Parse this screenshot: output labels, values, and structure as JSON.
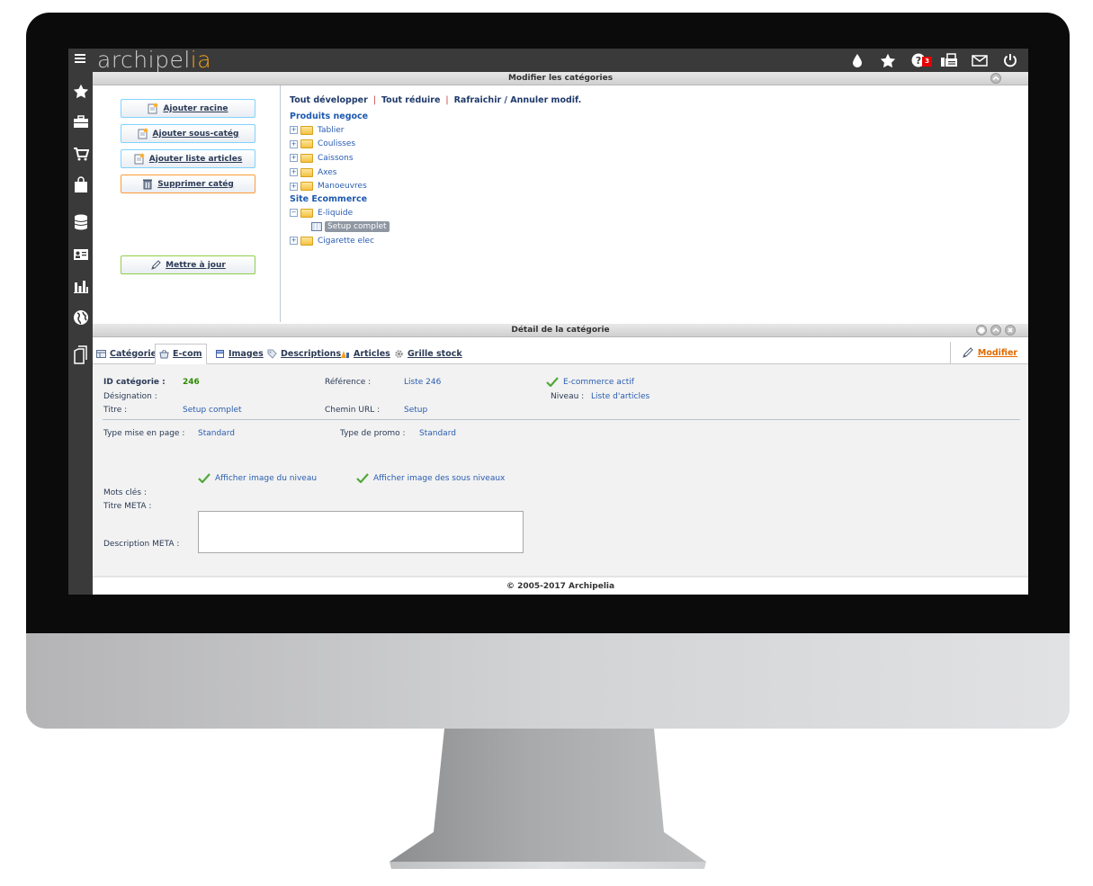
{
  "app": {
    "logo_text": "archipel",
    "logo_accent": "ia",
    "accent_color": "#f3a11a"
  },
  "topbar": {
    "help_badge": "3",
    "icons": [
      "drop-icon",
      "star-icon",
      "help-icon",
      "fax-icon",
      "mail-icon",
      "power-icon"
    ]
  },
  "sidebar": {
    "icons": [
      "star-icon",
      "briefcase-icon",
      "cart-icon",
      "shopping-bag-icon",
      "database-icon",
      "contact-card-icon",
      "bar-chart-icon",
      "globe-icon",
      "copy-icon"
    ]
  },
  "categories_panel": {
    "title": "Modifier les catégories",
    "buttons": {
      "add_root": "Ajouter racine",
      "add_subcat": "Ajouter sous-catég",
      "add_article_list": "Ajouter liste articles",
      "delete_cat": "Supprimer catég",
      "update": "Mettre à jour"
    },
    "tree_actions": {
      "expand_all": "Tout développer",
      "collapse_all": "Tout réduire",
      "refresh": "Rafraichir / Annuler modif."
    },
    "roots": [
      {
        "label": "Produits negoce",
        "children": [
          "Tablier",
          "Coulisses",
          "Caissons",
          "Axes",
          "Manoeuvres"
        ]
      },
      {
        "label": "Site Ecommerce",
        "children": [
          "E-liquide",
          "Cigarette elec"
        ],
        "expanded_child": "E-liquide",
        "selected_leaf": "Setup complet"
      }
    ]
  },
  "detail_panel": {
    "title": "Détail de la catégorie",
    "tabs": [
      "Catégorie",
      "E-com",
      "Images",
      "Descriptions",
      "Articles",
      "Grille stock"
    ],
    "active_tab": "E-com",
    "modify_label": "Modifier",
    "fields": {
      "id_label": "ID catégorie :",
      "id_value": "246",
      "reference_label": "Référence :",
      "reference_value": "Liste 246",
      "ecom_active": "E-commerce actif",
      "designation_label": "Désignation :",
      "niveau_label": "Niveau :",
      "niveau_value": "Liste d'articles",
      "titre_label": "Titre :",
      "titre_value": "Setup complet",
      "chemin_label": "Chemin URL :",
      "chemin_value": "Setup",
      "type_page_label": "Type mise en page :",
      "type_page_value": "Standard",
      "type_promo_label": "Type de promo :",
      "type_promo_value": "Standard",
      "show_level_image": "Afficher image du niveau",
      "show_sublevel_image": "Afficher image des sous niveaux",
      "keywords_label": "Mots clés :",
      "meta_title_label": "Titre META :",
      "meta_desc_label": "Description META :",
      "meta_desc_value": ""
    }
  },
  "footer": {
    "copyright": "© 2005-2017 Archipelia"
  }
}
